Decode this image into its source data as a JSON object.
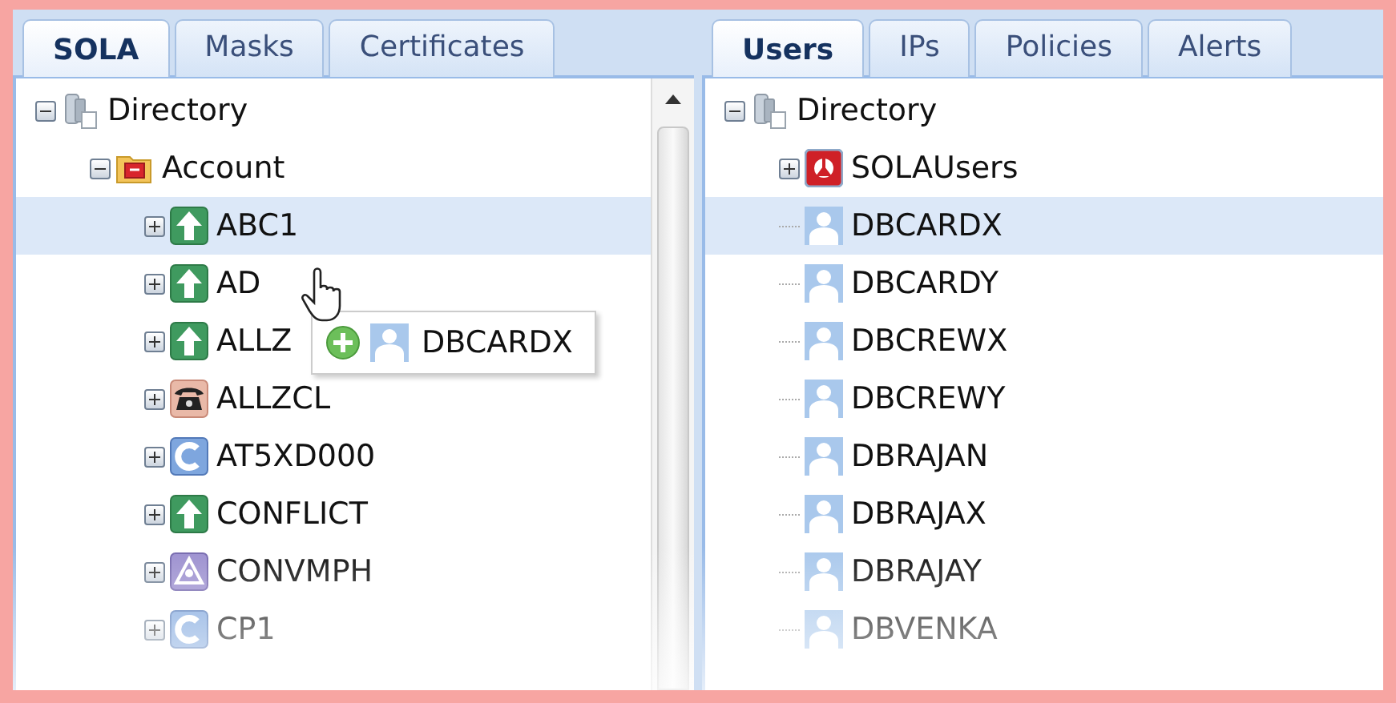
{
  "left_panel": {
    "tabs": [
      {
        "label": "SOLA",
        "selected": true
      },
      {
        "label": "Masks",
        "selected": false
      },
      {
        "label": "Certificates",
        "selected": false
      }
    ],
    "tree": [
      {
        "label": "Directory",
        "kind": "directory",
        "expanded": true,
        "selected": false,
        "children": [
          {
            "label": "Account",
            "kind": "folder",
            "expanded": true,
            "selected": false,
            "children": [
              {
                "label": "ABC1",
                "kind": "arrow",
                "expanded": false,
                "selected": true
              },
              {
                "label": "AD",
                "kind": "arrow",
                "expanded": false,
                "selected": false
              },
              {
                "label": "ALLZ",
                "kind": "arrow",
                "expanded": false,
                "selected": false
              },
              {
                "label": "ALLZCL",
                "kind": "phone",
                "expanded": false,
                "selected": false
              },
              {
                "label": "AT5XD000",
                "kind": "letter",
                "expanded": false,
                "selected": false
              },
              {
                "label": "CONFLICT",
                "kind": "arrow",
                "expanded": false,
                "selected": false
              },
              {
                "label": "CONVMPH",
                "kind": "network",
                "expanded": false,
                "selected": false
              },
              {
                "label": "CP1",
                "kind": "letter",
                "expanded": false,
                "selected": false
              }
            ]
          }
        ]
      }
    ]
  },
  "drag_tooltip": {
    "label": "DBCARDX"
  },
  "right_panel": {
    "tabs": [
      {
        "label": "Users",
        "selected": true
      },
      {
        "label": "IPs",
        "selected": false
      },
      {
        "label": "Policies",
        "selected": false
      },
      {
        "label": "Alerts",
        "selected": false
      }
    ],
    "tree": [
      {
        "label": "Directory",
        "kind": "directory",
        "expanded": true,
        "selected": false,
        "children": [
          {
            "label": "SOLAUsers",
            "kind": "group",
            "expanded": false,
            "selected": false
          },
          {
            "label": "DBCARDX",
            "kind": "user",
            "selected": true
          },
          {
            "label": "DBCARDY",
            "kind": "user",
            "selected": false
          },
          {
            "label": "DBCREWX",
            "kind": "user",
            "selected": false
          },
          {
            "label": "DBCREWY",
            "kind": "user",
            "selected": false
          },
          {
            "label": "DBRAJAN",
            "kind": "user",
            "selected": false
          },
          {
            "label": "DBRAJAX",
            "kind": "user",
            "selected": false
          },
          {
            "label": "DBRAJAY",
            "kind": "user",
            "selected": false
          },
          {
            "label": "DBVENKA",
            "kind": "user",
            "selected": false
          }
        ]
      }
    ]
  }
}
